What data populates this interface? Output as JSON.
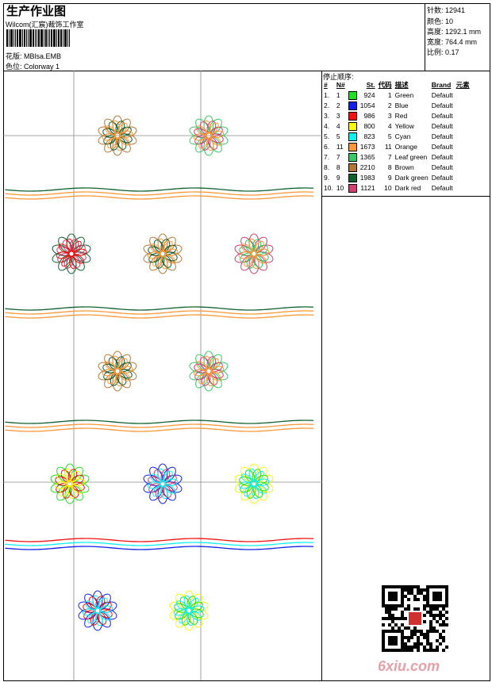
{
  "header": {
    "title": "生产作业图",
    "studio": "Wilcom(汇宸)裁饰工作室",
    "design_label": "花版: MBlsa.EMB",
    "colorway_label": "色位: Colorway 1"
  },
  "info": [
    {
      "label": "针数: 12941"
    },
    {
      "label": "颜色: 10"
    },
    {
      "label": "高度: 1292.1 mm"
    },
    {
      "label": "宽度: 764.4 mm"
    },
    {
      "label": "比例: 0.17"
    }
  ],
  "stop_sequence": {
    "title": "停止顺序:",
    "columns": [
      "#",
      "N#",
      "",
      "St.",
      "代码",
      "描述",
      "Brand",
      "元素"
    ],
    "rows": [
      {
        "idx": "1.",
        "n": "1",
        "color": "#22e022",
        "st": "924",
        "code": "1",
        "desc": "Green",
        "brand": "Default"
      },
      {
        "idx": "2.",
        "n": "2",
        "color": "#1020e8",
        "st": "1054",
        "code": "2",
        "desc": "Blue",
        "brand": "Default"
      },
      {
        "idx": "3.",
        "n": "3",
        "color": "#f01010",
        "st": "986",
        "code": "3",
        "desc": "Red",
        "brand": "Default"
      },
      {
        "idx": "4.",
        "n": "4",
        "color": "#f8f810",
        "st": "800",
        "code": "4",
        "desc": "Yellow",
        "brand": "Default"
      },
      {
        "idx": "5.",
        "n": "5",
        "color": "#10f0f0",
        "st": "823",
        "code": "5",
        "desc": "Cyan",
        "brand": "Default"
      },
      {
        "idx": "6.",
        "n": "11",
        "color": "#f89838",
        "st": "1673",
        "code": "11",
        "desc": "Orange",
        "brand": "Default"
      },
      {
        "idx": "7.",
        "n": "7",
        "color": "#38c868",
        "st": "1365",
        "code": "7",
        "desc": "Leaf green",
        "brand": "Default"
      },
      {
        "idx": "8.",
        "n": "8",
        "color": "#b07838",
        "st": "2210",
        "code": "8",
        "desc": "Brown",
        "brand": "Default"
      },
      {
        "idx": "9.",
        "n": "9",
        "color": "#106030",
        "st": "1983",
        "code": "9",
        "desc": "Dark green",
        "brand": "Default"
      },
      {
        "idx": "10.",
        "n": "10",
        "color": "#d04070",
        "st": "1121",
        "code": "10",
        "desc": "Dark red",
        "brand": "Default"
      }
    ]
  },
  "watermark": "6xiu.com"
}
